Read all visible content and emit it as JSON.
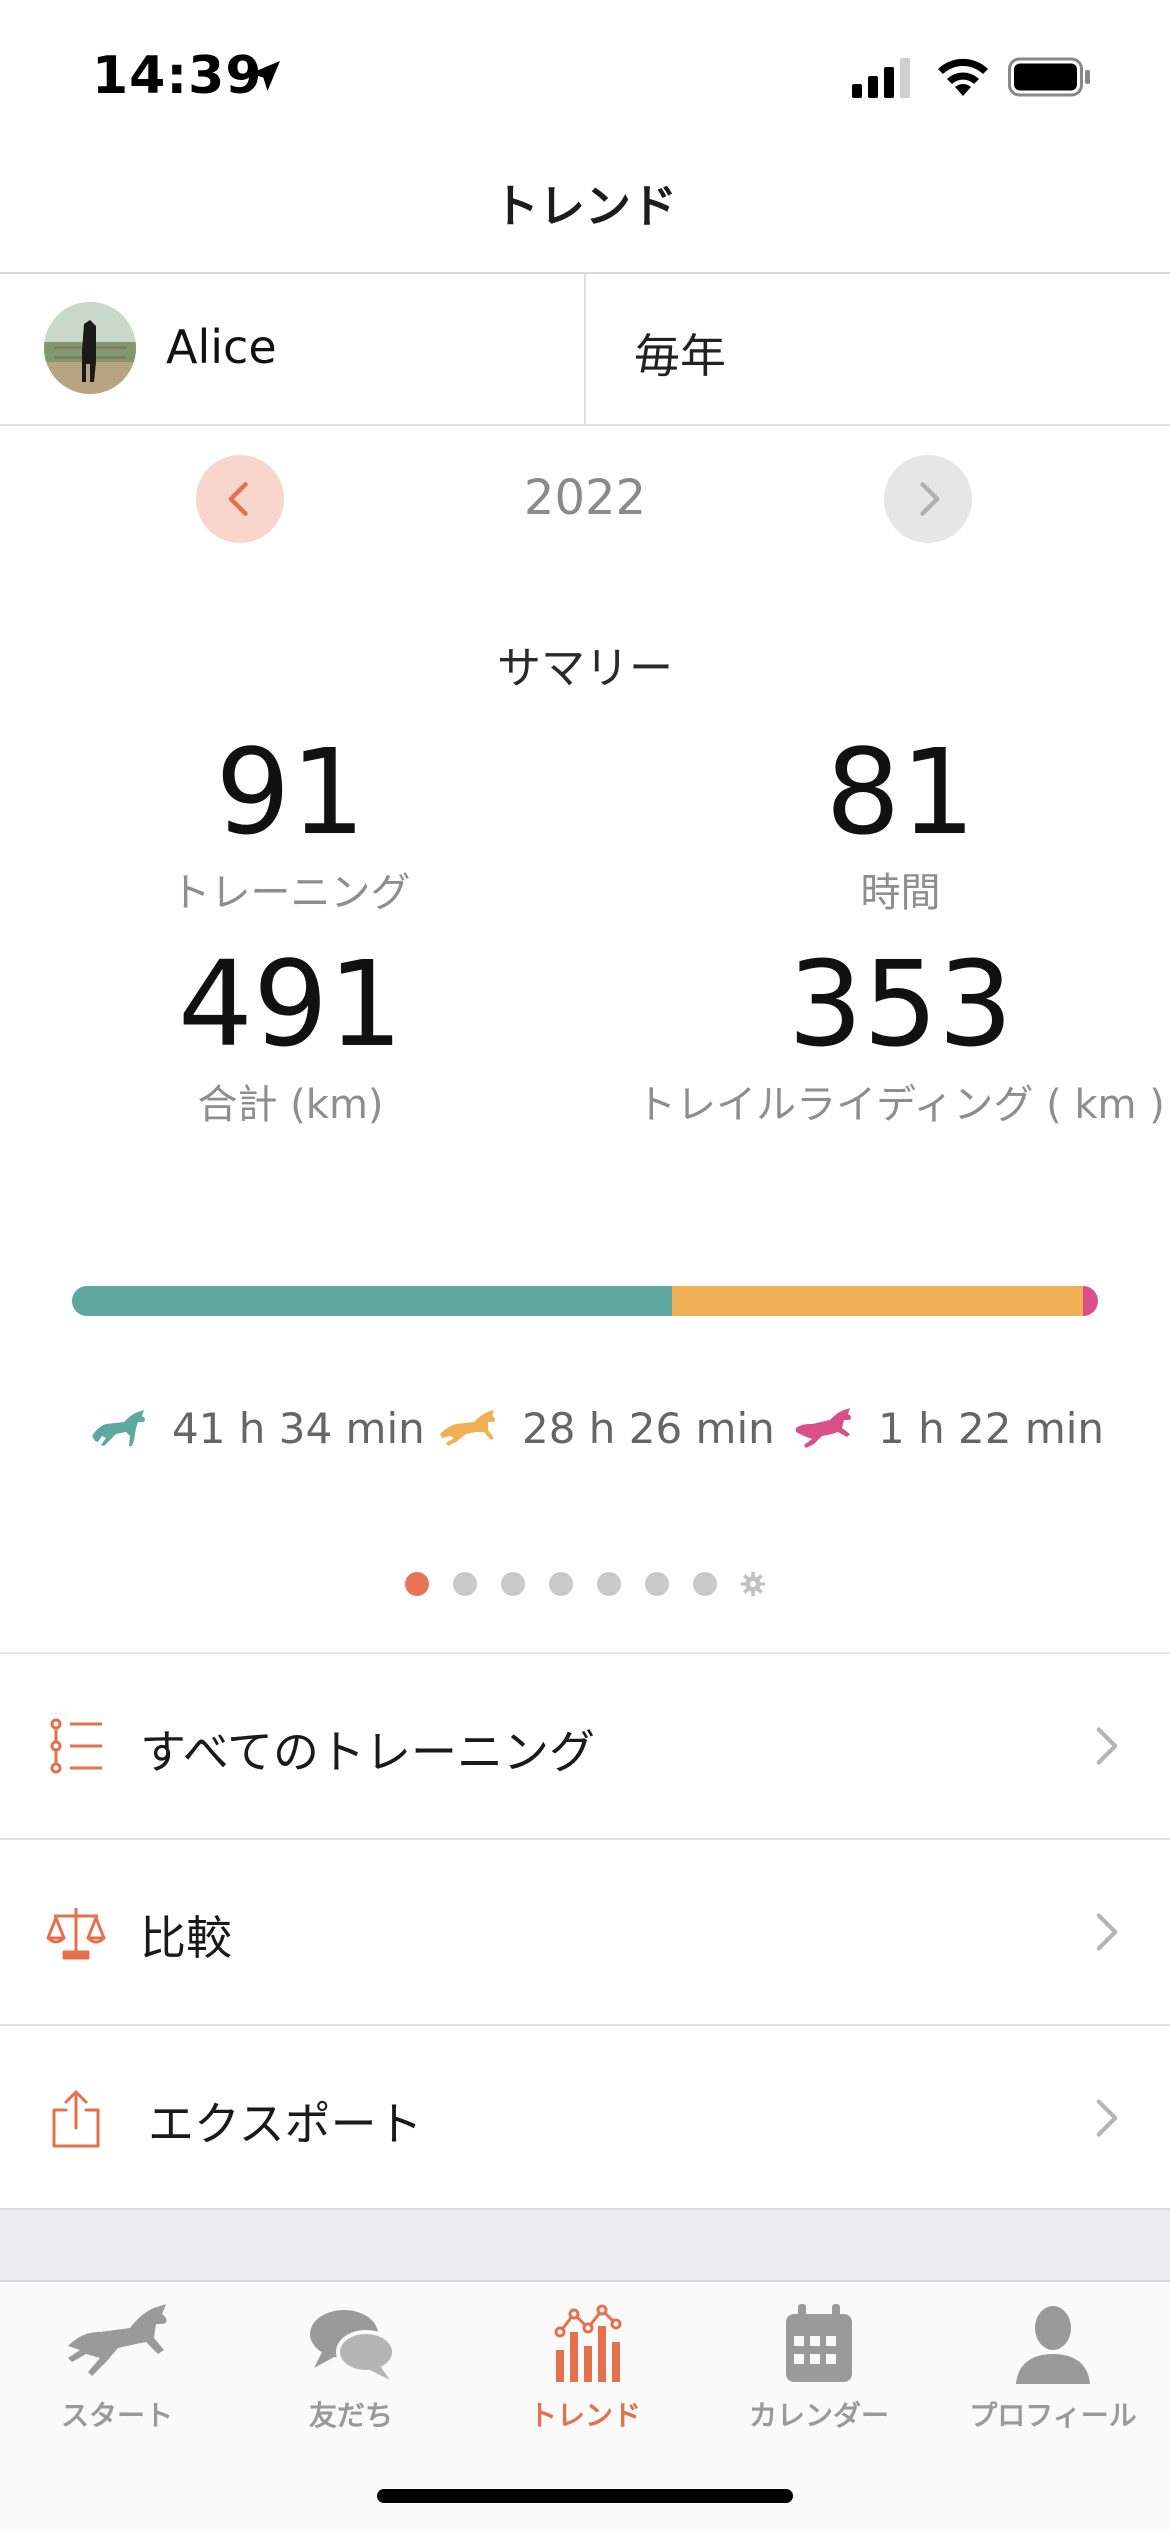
{
  "status_bar": {
    "time": "14:39"
  },
  "nav": {
    "title": "トレンド"
  },
  "user": {
    "name": "Alice"
  },
  "period": {
    "label": "毎年"
  },
  "year_selector": {
    "year": "2022"
  },
  "summary": {
    "title": "サマリー",
    "stats": [
      {
        "value": "91",
        "label": "トレーニング"
      },
      {
        "value": "81",
        "label": "時間"
      },
      {
        "value": "491",
        "label": "合計 (km)"
      },
      {
        "value": "353",
        "label": "トレイルライディング ( km )"
      }
    ]
  },
  "gait_breakdown": {
    "segments": [
      {
        "name": "walk",
        "color": "#5fa8a0",
        "fraction": 0.585
      },
      {
        "name": "trot",
        "color": "#f0b055",
        "fraction": 0.4
      },
      {
        "name": "canter",
        "color": "#d94f8a",
        "fraction": 0.015
      }
    ],
    "legend": [
      {
        "icon": "horse-walk-icon",
        "color": "#5fa8a0",
        "text": "41 h 34 min"
      },
      {
        "icon": "horse-trot-icon",
        "color": "#f0b055",
        "text": "28 h 26 min"
      },
      {
        "icon": "horse-canter-icon",
        "color": "#d94f8a",
        "text": "1 h 22 min"
      }
    ]
  },
  "pager": {
    "count": 7,
    "active_index": 0,
    "accent": "#e57553"
  },
  "menu": [
    {
      "icon": "list-icon",
      "label": "すべてのトレーニング"
    },
    {
      "icon": "scale-icon",
      "label": "比較"
    },
    {
      "icon": "share-icon",
      "label": "エクスポート"
    }
  ],
  "tabs": [
    {
      "icon": "horse-icon",
      "label": "スタート",
      "active": false
    },
    {
      "icon": "chat-icon",
      "label": "友だち",
      "active": false
    },
    {
      "icon": "trend-chart-icon",
      "label": "トレンド",
      "active": true
    },
    {
      "icon": "calendar-icon",
      "label": "カレンダー",
      "active": false
    },
    {
      "icon": "profile-icon",
      "label": "プロフィール",
      "active": false
    }
  ],
  "colors": {
    "accent": "#e5704c",
    "walk": "#5fa8a0",
    "trot": "#f0b055",
    "canter": "#d94f8a"
  }
}
